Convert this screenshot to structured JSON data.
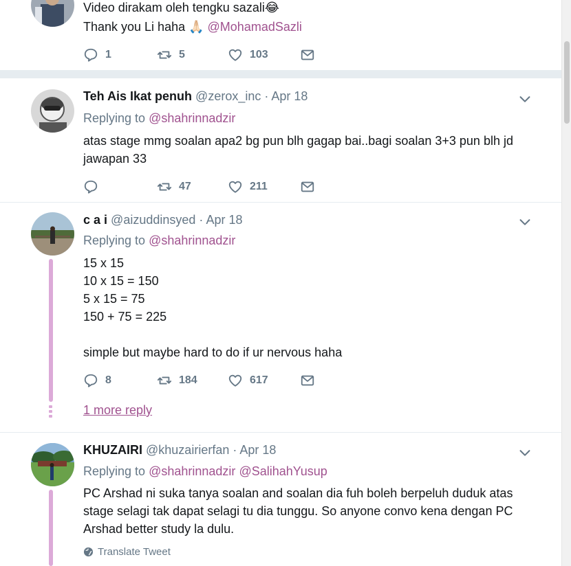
{
  "tweets": [
    {
      "lines": [
        "Video dirakam oleh tengku sazali😂",
        "Thank you Li haha 🙏🏻 "
      ],
      "line2_mention": "@MohamadSazli",
      "actions": {
        "reply": "1",
        "retweet": "5",
        "like": "103"
      }
    },
    {
      "name": "Teh Ais Ikat penuh",
      "handle": "@zerox_inc",
      "dot": "·",
      "date": "Apr 18",
      "replying_label": "Replying to",
      "replying_to": [
        "@shahrinnadzir"
      ],
      "lines": [
        "atas stage mmg soalan apa2 bg pun blh gagap bai..bagi soalan 3+3 pun blh jd",
        "jawapan 33"
      ],
      "actions": {
        "reply": "",
        "retweet": "47",
        "like": "211"
      }
    },
    {
      "name": "c a i",
      "handle": "@aizuddinsyed",
      "dot": "·",
      "date": "Apr 18",
      "replying_label": "Replying to",
      "replying_to": [
        "@shahrinnadzir"
      ],
      "lines": [
        "15 x 15",
        "10 x 15 = 150",
        "5 x 15 = 75",
        "150 + 75 = 225",
        "",
        "simple but maybe hard to do if ur nervous haha"
      ],
      "actions": {
        "reply": "8",
        "retweet": "184",
        "like": "617"
      },
      "more_reply": "1 more reply"
    },
    {
      "name": "KHUZAIRI",
      "handle": "@khuzairierfan",
      "dot": "·",
      "date": "Apr 18",
      "replying_label": "Replying to",
      "replying_to": [
        "@shahrinnadzir",
        "@SalihahYusup"
      ],
      "lines": [
        "PC Arshad ni suka tanya soalan and soalan dia fuh boleh berpeluh duduk atas",
        "stage selagi tak dapat selagi tu dia tunggu. So anyone convo kena dengan PC",
        "Arshad better study la dulu."
      ],
      "translate": "Translate Tweet"
    }
  ],
  "icons": {
    "reply": "reply-icon",
    "retweet": "retweet-icon",
    "like": "heart-icon",
    "dm": "envelope-icon",
    "caret": "chevron-down-icon",
    "globe": "globe-icon"
  },
  "colors": {
    "link": "#a0528f",
    "thread": "#dcaad8",
    "secondary": "#657786",
    "divider": "#e6ecf0"
  }
}
